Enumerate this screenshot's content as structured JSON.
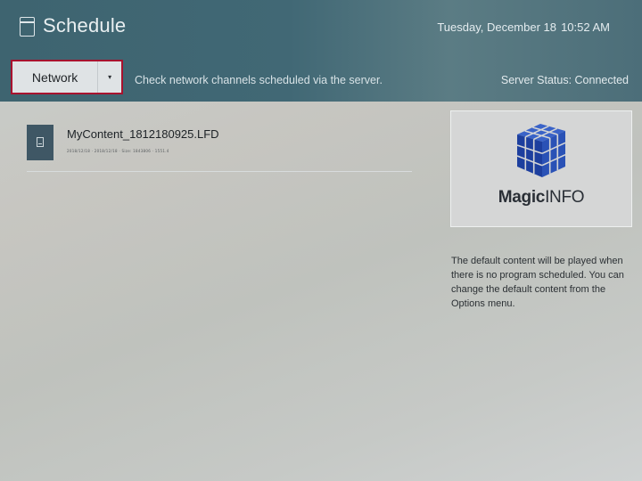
{
  "header": {
    "title": "Schedule",
    "date": "Tuesday, December 18",
    "time": "10:52 AM",
    "title_icon": "calendar-icon"
  },
  "toolbar": {
    "dropdown": {
      "selected": "Network",
      "arrow": "▾"
    },
    "hint": "Check network channels scheduled via the server.",
    "server_status": "Server Status: Connected"
  },
  "content_list": {
    "items": [
      {
        "name": "MyContent_1812180925.LFD",
        "meta": "2018/12/18 · 2018/12/18 · Size: 1843806 · 1551.4",
        "icon": "file-icon"
      }
    ]
  },
  "default_content": {
    "logo_bold": "Magic",
    "logo_light": "INFO",
    "description": "The default content will be played when there is no program scheduled. You can change the default content from the Options menu."
  },
  "colors": {
    "topbar": "#416875",
    "focus_border": "#a8122e",
    "cube_blue": "#1d3f9e"
  }
}
